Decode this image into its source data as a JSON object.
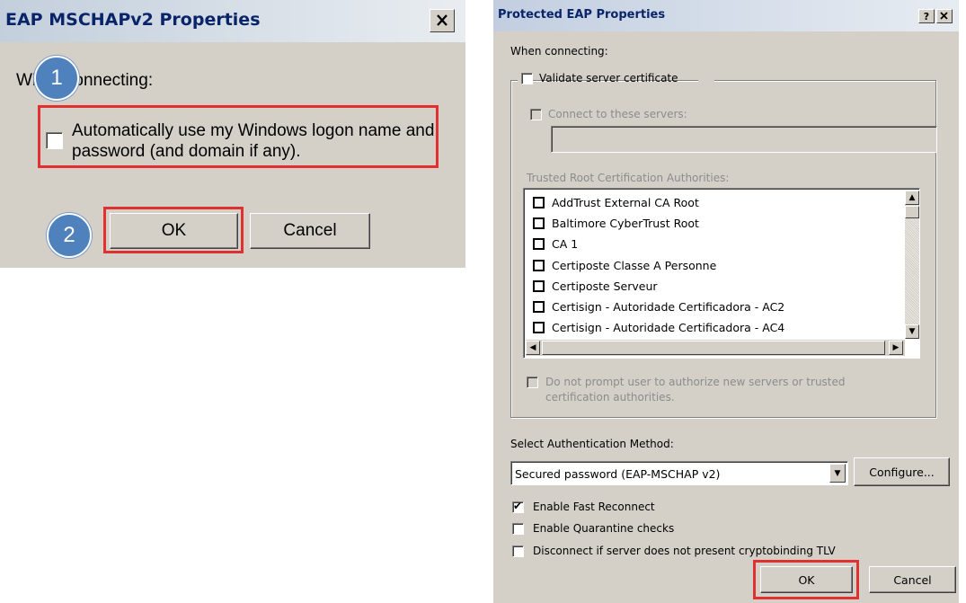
{
  "left_dialog": {
    "title": "EAP MSCHAPv2 Properties",
    "close_glyph": "✕",
    "when_connecting": "When connecting:",
    "auto_logon_label": "Automatically use my Windows logon name and password (and domain if any).",
    "auto_logon_checked": false,
    "ok_label": "OK",
    "cancel_label": "Cancel",
    "step_badges": [
      "1",
      "2"
    ],
    "highlight_color": "#e03030"
  },
  "right_dialog": {
    "title": "Protected EAP Properties",
    "help_glyph": "?",
    "close_glyph": "✕",
    "when_connecting": "When connecting:",
    "validate_cert_label": "Validate server certificate",
    "validate_cert_checked": false,
    "connect_servers_label": "Connect to these servers:",
    "servers_value": "",
    "trusted_root_label": "Trusted Root Certification Authorities:",
    "cert_authorities": [
      "AddTrust External CA Root",
      "Baltimore CyberTrust Root",
      "CA 1",
      "Certiposte Classe A Personne",
      "Certiposte Serveur",
      "Certisign - Autoridade Certificadora - AC2",
      "Certisign - Autoridade Certificadora - AC4"
    ],
    "no_prompt_label_line1": "Do not prompt user to authorize new servers or trusted",
    "no_prompt_label_line2": "certification authorities.",
    "auth_method_label": "Select Authentication Method:",
    "auth_method_value": "Secured password (EAP-MSCHAP v2)",
    "configure_label": "Configure...",
    "options": [
      {
        "label": "Enable Fast Reconnect",
        "checked": true
      },
      {
        "label": "Enable Quarantine checks",
        "checked": false
      },
      {
        "label": "Disconnect if server does not present cryptobinding TLV",
        "checked": false
      }
    ],
    "ok_label": "OK",
    "cancel_label": "Cancel"
  },
  "colors": {
    "dialog_bg": "#d4d0c8",
    "title_text": "#0a246a",
    "badge_fill": "#4f81bd",
    "highlight": "#e03030"
  }
}
